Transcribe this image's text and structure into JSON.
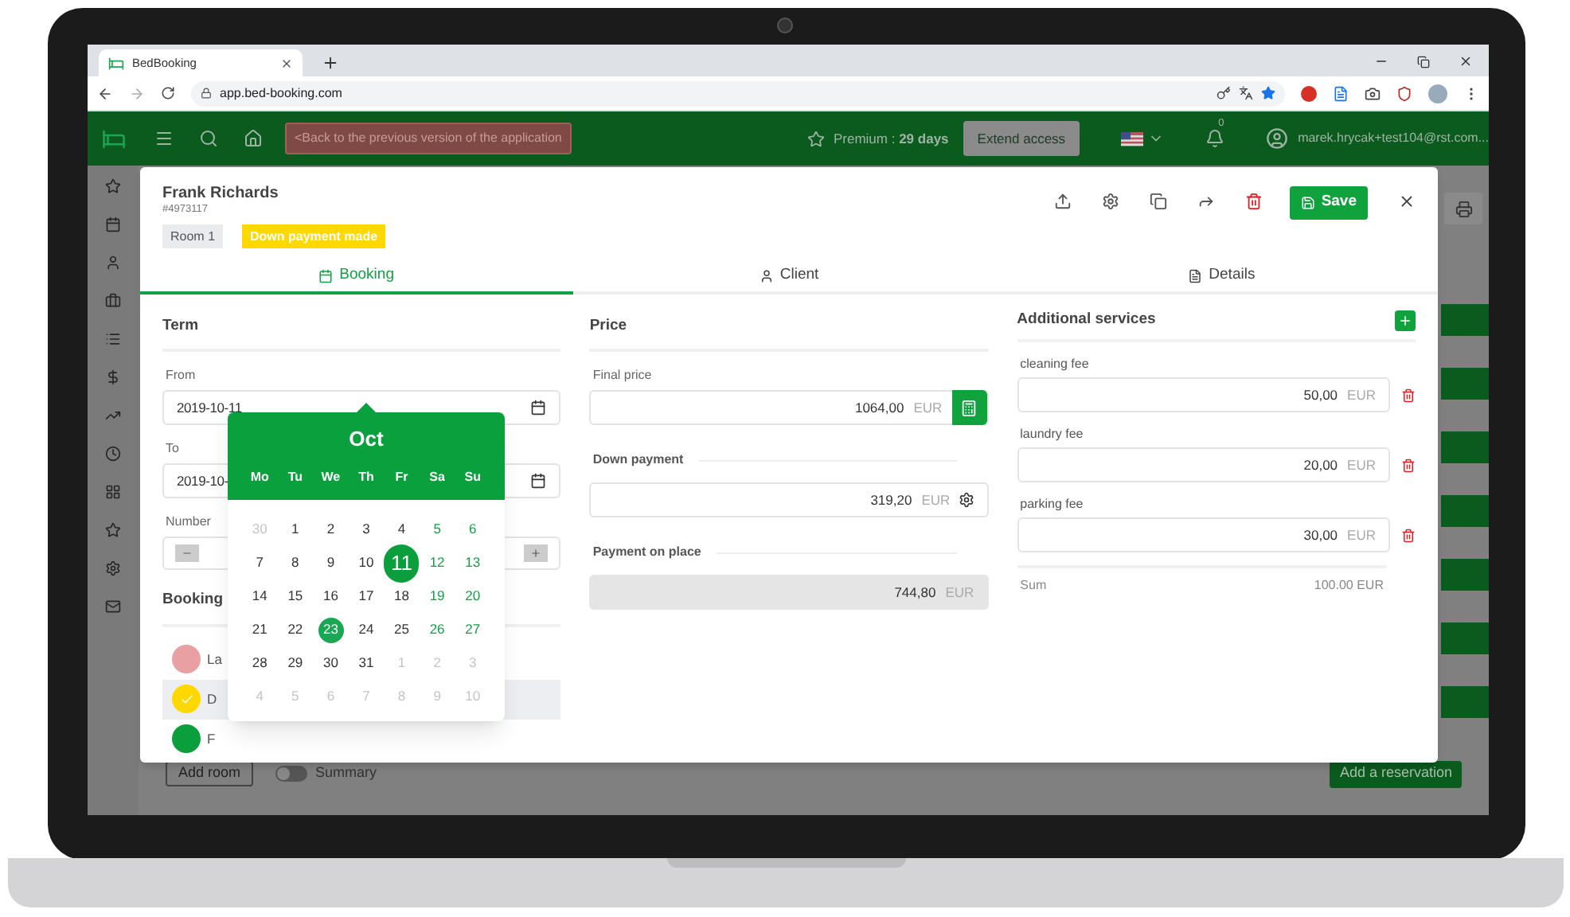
{
  "browser": {
    "tab_title": "BedBooking",
    "url": "app.bed-booking.com"
  },
  "header": {
    "back_link": "<Back to the previous version of the application",
    "premium": "Premium : **29 days**",
    "extend_button": "Extend access",
    "notifications_count": "0",
    "user_email": "marek.hrycak+test104@rst.com..."
  },
  "background": {
    "add_room": "Add room",
    "summary": {
      "label": "Summary",
      "on": false
    },
    "add_reservation": "Add a reservation"
  },
  "modal": {
    "name": "Frank Richards",
    "number": "#4973117",
    "room": "Room 1",
    "status": "Down payment made",
    "save": "Save",
    "tabs": [
      {
        "label": "Booking",
        "selected": true
      },
      {
        "label": "Client",
        "selected": false
      },
      {
        "label": "Details",
        "selected": false
      }
    ],
    "term": {
      "title": "Term",
      "from_label": "From",
      "from_value": "2019-10-11",
      "to_label": "To",
      "to_value": "2019-10-",
      "number_label": "Number"
    },
    "booking": {
      "title": "Booking",
      "statuses": [
        {
          "label": "La",
          "color": "#e8a0a2",
          "selected": false
        },
        {
          "label": "D",
          "color": "#ffd800",
          "selected": true
        },
        {
          "label": "F",
          "color": "#0a9e3c",
          "selected": false
        }
      ]
    },
    "price": {
      "title": "Price",
      "fields": [
        {
          "label": "Final price",
          "value": "1064,00",
          "currency": "EUR",
          "kind": "calc"
        },
        {
          "label": "Down payment",
          "value": "319,20",
          "currency": "EUR",
          "kind": "settings"
        },
        {
          "label": "Payment on place",
          "value": "744,80",
          "currency": "EUR",
          "kind": "readonly"
        }
      ]
    },
    "services": {
      "title": "Additional services",
      "items": [
        {
          "label": "cleaning fee",
          "value": "50,00",
          "currency": "EUR"
        },
        {
          "label": "laundry fee",
          "value": "20,00",
          "currency": "EUR"
        },
        {
          "label": "parking fee",
          "value": "30,00",
          "currency": "EUR"
        }
      ],
      "sum_label": "Sum",
      "sum_value": "100.00 EUR"
    },
    "calendar": {
      "month": "Oct",
      "weekdays": [
        "Mo",
        "Tu",
        "We",
        "Th",
        "Fr",
        "Sa",
        "Su"
      ],
      "days": [
        {
          "d": "30",
          "kind": "muted"
        },
        {
          "d": "1",
          "kind": "plain"
        },
        {
          "d": "2",
          "kind": "plain"
        },
        {
          "d": "3",
          "kind": "plain"
        },
        {
          "d": "4",
          "kind": "plain"
        },
        {
          "d": "5",
          "kind": "weekend"
        },
        {
          "d": "6",
          "kind": "weekend"
        },
        {
          "d": "7",
          "kind": "plain"
        },
        {
          "d": "8",
          "kind": "plain"
        },
        {
          "d": "9",
          "kind": "plain"
        },
        {
          "d": "10",
          "kind": "plain"
        },
        {
          "d": "11",
          "kind": "selected"
        },
        {
          "d": "12",
          "kind": "weekend"
        },
        {
          "d": "13",
          "kind": "weekend"
        },
        {
          "d": "14",
          "kind": "plain"
        },
        {
          "d": "15",
          "kind": "plain"
        },
        {
          "d": "16",
          "kind": "plain"
        },
        {
          "d": "17",
          "kind": "plain"
        },
        {
          "d": "18",
          "kind": "plain"
        },
        {
          "d": "19",
          "kind": "weekend"
        },
        {
          "d": "20",
          "kind": "weekend"
        },
        {
          "d": "21",
          "kind": "plain"
        },
        {
          "d": "22",
          "kind": "plain"
        },
        {
          "d": "23",
          "kind": "today"
        },
        {
          "d": "24",
          "kind": "plain"
        },
        {
          "d": "25",
          "kind": "plain"
        },
        {
          "d": "26",
          "kind": "weekend"
        },
        {
          "d": "27",
          "kind": "weekend"
        },
        {
          "d": "28",
          "kind": "plain"
        },
        {
          "d": "29",
          "kind": "plain"
        },
        {
          "d": "30",
          "kind": "plain"
        },
        {
          "d": "31",
          "kind": "plain"
        },
        {
          "d": "1",
          "kind": "muted"
        },
        {
          "d": "2",
          "kind": "muted"
        },
        {
          "d": "3",
          "kind": "muted"
        },
        {
          "d": "4",
          "kind": "muted"
        },
        {
          "d": "5",
          "kind": "muted"
        },
        {
          "d": "6",
          "kind": "muted"
        },
        {
          "d": "7",
          "kind": "muted"
        },
        {
          "d": "8",
          "kind": "muted"
        },
        {
          "d": "9",
          "kind": "muted"
        },
        {
          "d": "10",
          "kind": "muted"
        }
      ]
    }
  }
}
